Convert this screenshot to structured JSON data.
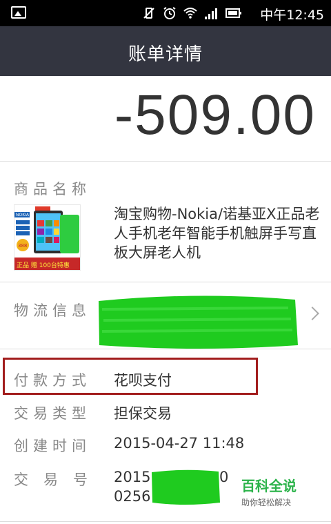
{
  "status_bar": {
    "time": "中午12:45",
    "icons": [
      "image-notification-icon",
      "vibrate-mute-icon",
      "alarm-icon",
      "wifi-icon",
      "signal-icon",
      "battery-icon"
    ]
  },
  "header": {
    "title": "账单详情"
  },
  "amount": "-509.00",
  "product": {
    "label": "商品名称",
    "name": "淘宝购物-Nokia/诺基亚X正品老人手机老年智能手机触屏手写直板大屏老人机",
    "image_text": {
      "brand": "NOKIA",
      "price": "388",
      "promo": "正品 赠 100台特惠"
    }
  },
  "logistics": {
    "label": "物流信息",
    "value": ""
  },
  "payment": {
    "label": "付款方式",
    "value": "花呗支付"
  },
  "trade_type": {
    "label": "交易类型",
    "value": "担保交易"
  },
  "created": {
    "label": "创建时间",
    "value": "2015-04-27 11:48"
  },
  "trade_no": {
    "label": "交易号",
    "line1": "2015",
    "line1_end": "0",
    "line2": "0256"
  },
  "watermark": {
    "title": "百科全说",
    "subtitle": "助你轻松解决"
  },
  "colors": {
    "titlebar": "#333540",
    "highlight_border": "#a21d1d",
    "scribble": "#1fcb1f",
    "watermark": "#2bb34a"
  }
}
